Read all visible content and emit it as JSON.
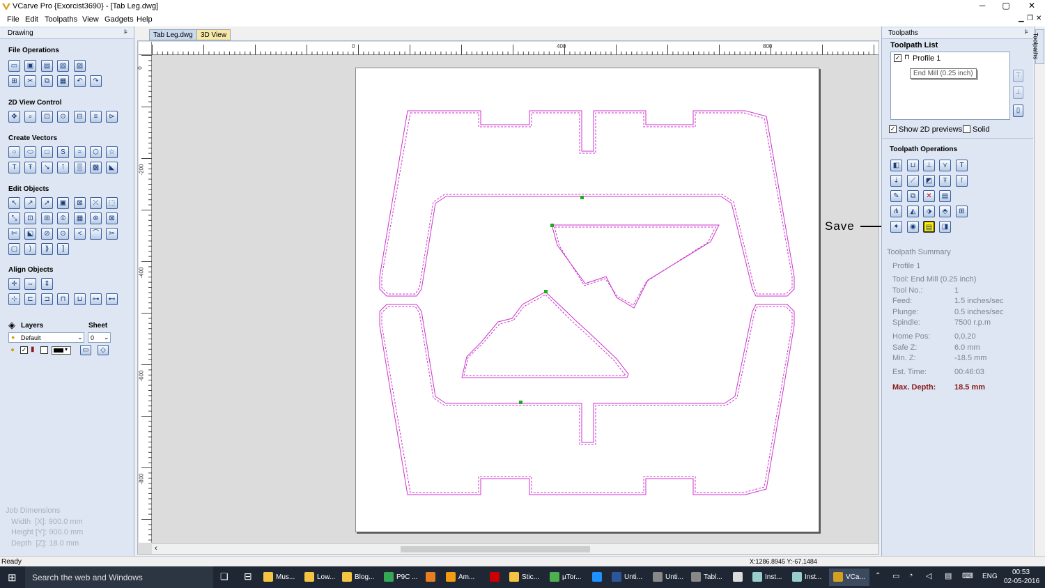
{
  "window": {
    "title": "VCarve Pro {Exorcist3690} - [Tab Leg.dwg]",
    "minimize": "─",
    "maximize": "▢",
    "close": "✕"
  },
  "menu": [
    "File",
    "Edit",
    "Toolpaths",
    "View",
    "Gadgets",
    "Help"
  ],
  "left_panel": {
    "title": "Drawing",
    "pin": "⊧",
    "sections": {
      "file_ops": "File Operations",
      "view_2d": "2D View Control",
      "create_vectors": "Create Vectors",
      "edit_objects": "Edit Objects",
      "align_objects": "Align Objects"
    },
    "layers_label": "Layers",
    "sheet_label": "Sheet",
    "layer_value": "Default",
    "sheet_value": "0",
    "job_dimensions": {
      "title": "Job Dimensions",
      "width": "Width  [X]: 900.0 mm",
      "height": "Height [Y]: 900.0 mm",
      "depth": "Depth  [Z]: 18.0 mm"
    }
  },
  "tabs": [
    {
      "label": "Tab Leg.dwg"
    },
    {
      "label": "3D View"
    }
  ],
  "ruler": {
    "h": [
      "0",
      "400",
      "800"
    ],
    "v": [
      "0",
      "-200",
      "-400",
      "-600",
      "-800"
    ]
  },
  "annotation": {
    "label": "Save"
  },
  "right_panel": {
    "title": "Toolpaths",
    "list_title": "Toolpath List",
    "profile_name": "Profile 1",
    "tooltip": "End Mill (0.25 inch)",
    "show_2d": "Show 2D previews",
    "solid": "Solid",
    "ops_title": "Toolpath Operations",
    "summary_title": "Toolpath Summary",
    "summary_profile": "Profile 1",
    "summary": [
      {
        "k": "Tool: End Mill (0.25 inch)",
        "v": ""
      },
      {
        "k": "Tool No.:",
        "v": "1"
      },
      {
        "k": "Feed:",
        "v": "1.5 inches/sec"
      },
      {
        "k": "Plunge:",
        "v": "0.5 inches/sec"
      },
      {
        "k": "Spindle:",
        "v": "7500 r.p.m"
      },
      {
        "k": "Home Pos:",
        "v": "0,0,20"
      },
      {
        "k": "Safe Z:",
        "v": "6.0 mm"
      },
      {
        "k": "Min. Z:",
        "v": "-18.5 mm"
      },
      {
        "k": "Est. Time:",
        "v": "00:46:03"
      }
    ],
    "max_depth_label": "Max. Depth:",
    "max_depth_value": "18.5 mm",
    "side_tab": "Toolpaths"
  },
  "status": {
    "ready": "Ready",
    "coords": "X:1286.8945 Y:-67.1484"
  },
  "taskbar": {
    "search": "Search the web and Windows",
    "apps": [
      "Mus...",
      "Low...",
      "Blog...",
      "P9C ...",
      "",
      "Am...",
      "",
      "Stic...",
      "µTor...",
      "",
      "Unti...",
      "Unti...",
      "Tabl...",
      "",
      "Inst...",
      "Inst...",
      "VCa..."
    ],
    "lang": "ENG",
    "time": "00:53",
    "date": "02-05-2016"
  },
  "colors": {
    "toolpath": "#cc33cc",
    "panel": "#dde6f2",
    "accent": "#1a3d7c",
    "maxdepth": "#8b1a1a"
  }
}
